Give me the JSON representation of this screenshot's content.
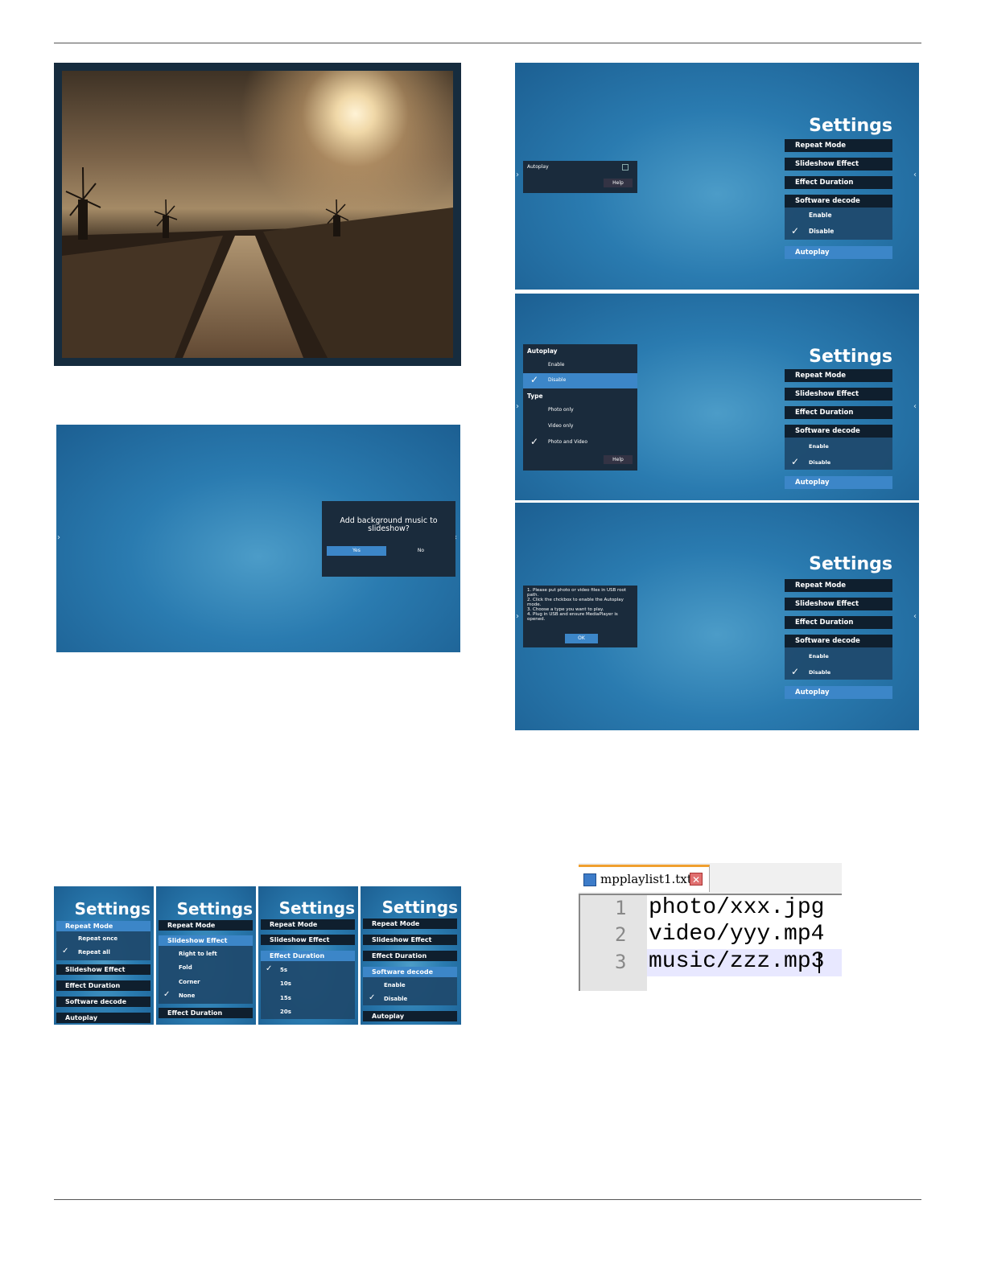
{
  "settings_menu": {
    "title": "Settings",
    "repeat_mode": "Repeat Mode",
    "slideshow_effect": "Slideshow Effect",
    "effect_duration": "Effect Duration",
    "software_decode": "Software decode",
    "autoplay": "Autoplay",
    "enable": "Enable",
    "disable": "Disable"
  },
  "music_dialog": {
    "question": "Add background music to slideshow?",
    "yes": "Yes",
    "no": "No"
  },
  "autoplay_small": {
    "label": "Autoplay",
    "help": "Help"
  },
  "autoplay_menu": {
    "header": "Autoplay",
    "enable": "Enable",
    "disable": "Disable",
    "type_header": "Type",
    "photo_only": "Photo only",
    "video_only": "Video only",
    "photo_and_video": "Photo and Video",
    "help": "Help"
  },
  "help_dialog": {
    "line1": "1. Please put photo or video files in USB root path.",
    "line2": "2. Click the chckbox to enable the Autoplay mode.",
    "line3": "3. Choose a type you want to play.",
    "line4": "4. Plug in USB and ensure MediaPlayer is opened.",
    "ok": "OK"
  },
  "strip": {
    "repeat_once": "Repeat once",
    "repeat_all": "Repeat all",
    "right_to_left": "Right to left",
    "fold": "Fold",
    "corner": "Corner",
    "none": "None",
    "d5": "5s",
    "d10": "10s",
    "d15": "15s",
    "d20": "20s"
  },
  "editor": {
    "tab_name": "mpplaylist1.txt",
    "lines": [
      {
        "num": "1",
        "text": "photo/xxx.jpg"
      },
      {
        "num": "2",
        "text": "video/yyy.mp4"
      },
      {
        "num": "3",
        "text": "music/zzz.mp3"
      }
    ]
  }
}
